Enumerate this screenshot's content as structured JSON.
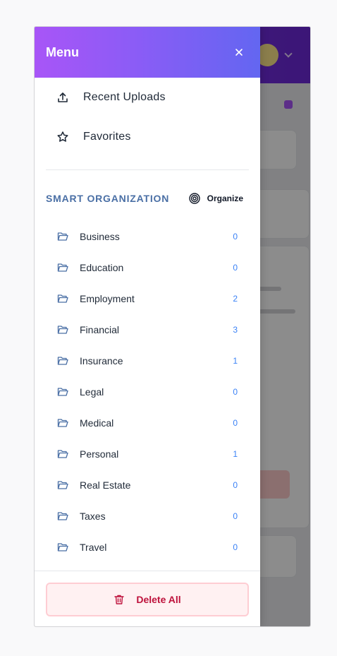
{
  "drawer": {
    "title": "Menu",
    "nav_items": [
      {
        "label": "Recent Uploads",
        "icon": "upload-icon"
      },
      {
        "label": "Favorites",
        "icon": "star-icon"
      }
    ],
    "section": {
      "title": "SMART ORGANIZATION",
      "organize_label": "Organize",
      "organize_icon": "target-icon"
    },
    "folders": [
      {
        "name": "Business",
        "count": "0"
      },
      {
        "name": "Education",
        "count": "0"
      },
      {
        "name": "Employment",
        "count": "2"
      },
      {
        "name": "Financial",
        "count": "3"
      },
      {
        "name": "Insurance",
        "count": "1"
      },
      {
        "name": "Legal",
        "count": "0"
      },
      {
        "name": "Medical",
        "count": "0"
      },
      {
        "name": "Personal",
        "count": "1"
      },
      {
        "name": "Real Estate",
        "count": "0"
      },
      {
        "name": "Taxes",
        "count": "0"
      },
      {
        "name": "Travel",
        "count": "0"
      }
    ],
    "delete_label": "Delete All"
  },
  "colors": {
    "header_gradient_start": "#a855f7",
    "header_gradient_end": "#6366f1",
    "section_title": "#4a6fa5",
    "count": "#3b82f6",
    "delete_text": "#be123c"
  }
}
